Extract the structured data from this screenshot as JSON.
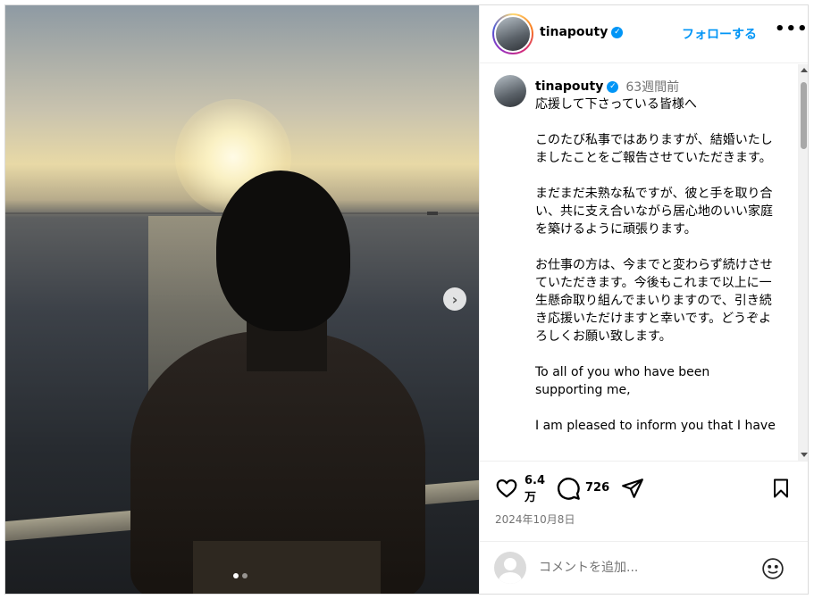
{
  "post": {
    "username": "tinapouty",
    "follow_label": "フォローする",
    "more_label": "•••",
    "verified_mark": "✓",
    "caption_time": "63週間前",
    "caption_text": "応援して下さっている皆様へ\n\nこのたび私事ではありますが、結婚いたしましたことをご報告させていただきます。\n\nまだまだ未熟な私ですが、彼と手を取り合い、共に支え合いながら居心地のいい家庭を築けるように頑張ります。\n\nお仕事の方は、今までと変わらず続けさせていただきます。今後もこれまで以上に一生懸命取り組んでまいりますので、引き続き応援いただけますと幸いです。どうぞよろしくお願い致します。\n\nTo all of you who have been supporting me,\n\nI am pleased to inform you that I have",
    "likes": "6.4\n万",
    "comments": "726",
    "date": "2024年10月8日"
  },
  "carousel": {
    "next_glyph": "›",
    "total_slides": 2,
    "active_slide": 1
  },
  "comment_bar": {
    "placeholder": "コメントを追加..."
  },
  "colors": {
    "accent": "#0095f6",
    "muted": "#737373",
    "border": "#dbdbdb"
  },
  "icons": [
    "heart-icon",
    "comment-icon",
    "share-icon",
    "bookmark-icon",
    "emoji-icon",
    "chevron-right-icon",
    "verified-badge-icon"
  ]
}
